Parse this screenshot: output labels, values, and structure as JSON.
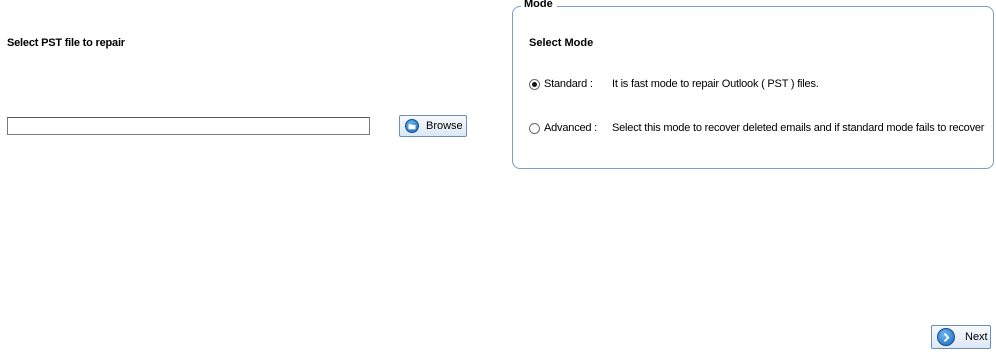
{
  "file_section": {
    "label": "Select PST file to repair",
    "input_value": "",
    "browse_label": "Browse"
  },
  "mode_section": {
    "legend": "Mode",
    "heading": "Select Mode",
    "options": [
      {
        "label": "Standard :",
        "description": "It is fast mode to repair Outlook ( PST ) files.",
        "selected": true
      },
      {
        "label": "Advanced :",
        "description": "Select this mode to recover deleted emails and if standard mode fails to recover",
        "selected": false
      }
    ]
  },
  "footer": {
    "next_label": "Next"
  },
  "icons": {
    "browse": "folder-circle-icon",
    "next": "arrow-right-circle-icon"
  },
  "colors": {
    "accent": "#1769b8",
    "group_border": "#7b9dc7",
    "button_border": "#6f8fb8"
  }
}
